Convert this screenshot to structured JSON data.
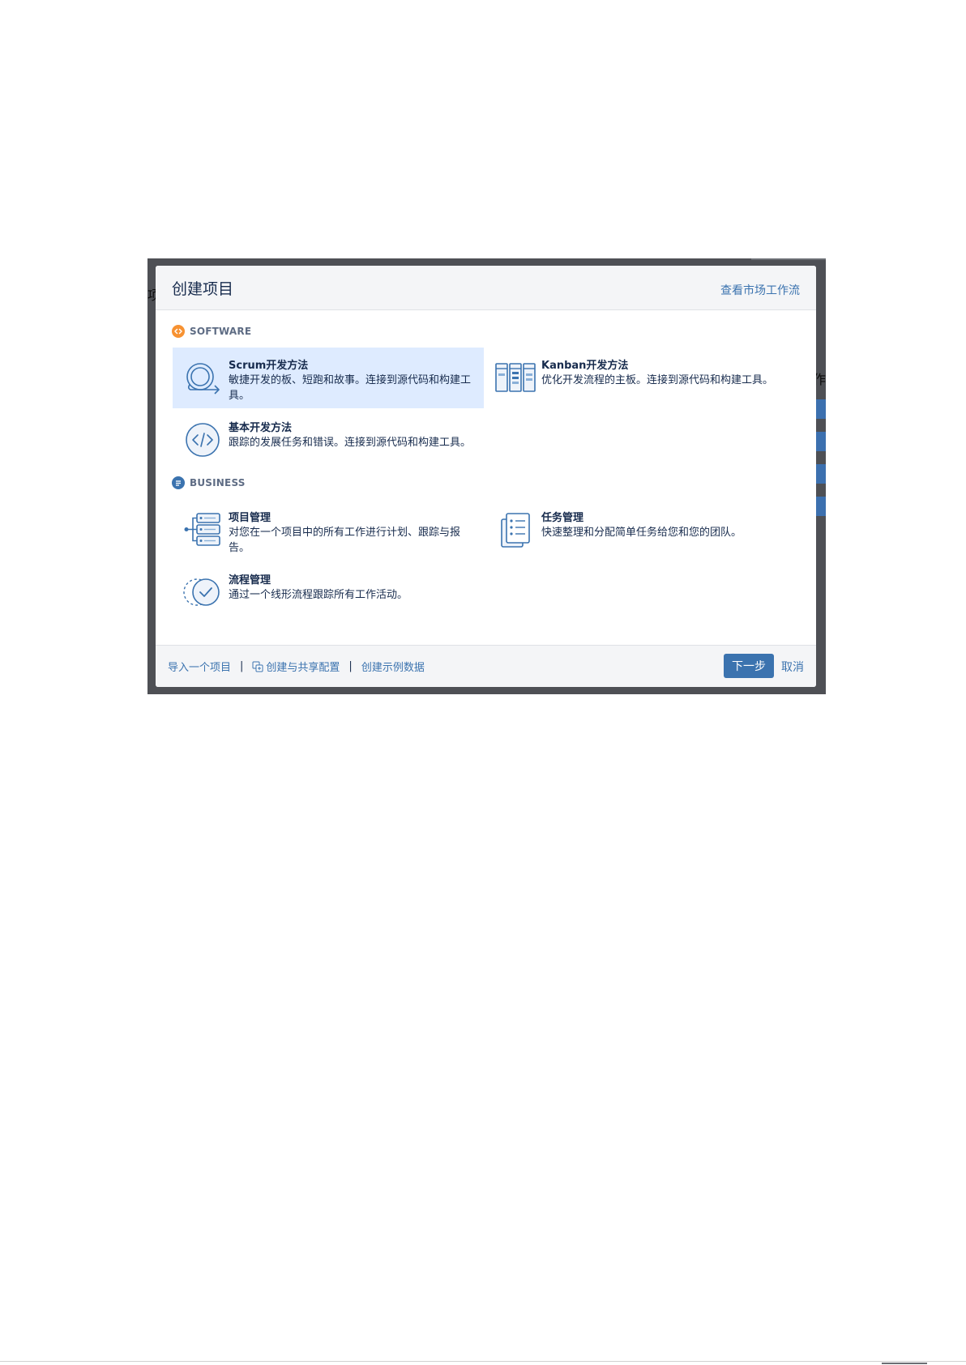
{
  "background_page": {
    "left_fragment": "项",
    "right_fragment": "作"
  },
  "dialog": {
    "title": "创建项目",
    "header_link": "查看市场工作流"
  },
  "sections": [
    {
      "label": "SOFTWARE",
      "icon": "code-icon",
      "color": "#f79232",
      "items": [
        {
          "title": "Scrum开发方法",
          "description": "敏捷开发的板、短跑和故事。连接到源代码和构建工具。",
          "icon": "scrum-loop-icon",
          "selected": true
        },
        {
          "title": "Kanban开发方法",
          "description": "优化开发流程的主板。连接到源代码和构建工具。",
          "icon": "kanban-board-icon",
          "selected": false
        },
        {
          "title": "基本开发方法",
          "description": "跟踪的发展任务和错误。连接到源代码和构建工具。",
          "icon": "code-brackets-icon",
          "selected": false
        }
      ]
    },
    {
      "label": "BUSINESS",
      "icon": "document-icon",
      "color": "#3b73af",
      "items": [
        {
          "title": "项目管理",
          "description": "对您在一个项目中的所有工作进行计划、跟踪与报告。",
          "icon": "server-stack-icon",
          "selected": false
        },
        {
          "title": "任务管理",
          "description": "快速整理和分配简单任务给您和您的团队。",
          "icon": "task-list-icon",
          "selected": false
        },
        {
          "title": "流程管理",
          "description": "通过一个线形流程跟踪所有工作活动。",
          "icon": "process-check-icon",
          "selected": false
        }
      ]
    }
  ],
  "footer": {
    "import_link": "导入一个项目",
    "separator": "|",
    "share_link": "创建与共享配置",
    "sample_link": "创建示例数据",
    "next_button": "下一步",
    "cancel_link": "取消"
  },
  "colors": {
    "primary": "#3b73af",
    "selected_bg": "#deebff",
    "software_accent": "#f79232",
    "overlay": "#4e5055"
  }
}
